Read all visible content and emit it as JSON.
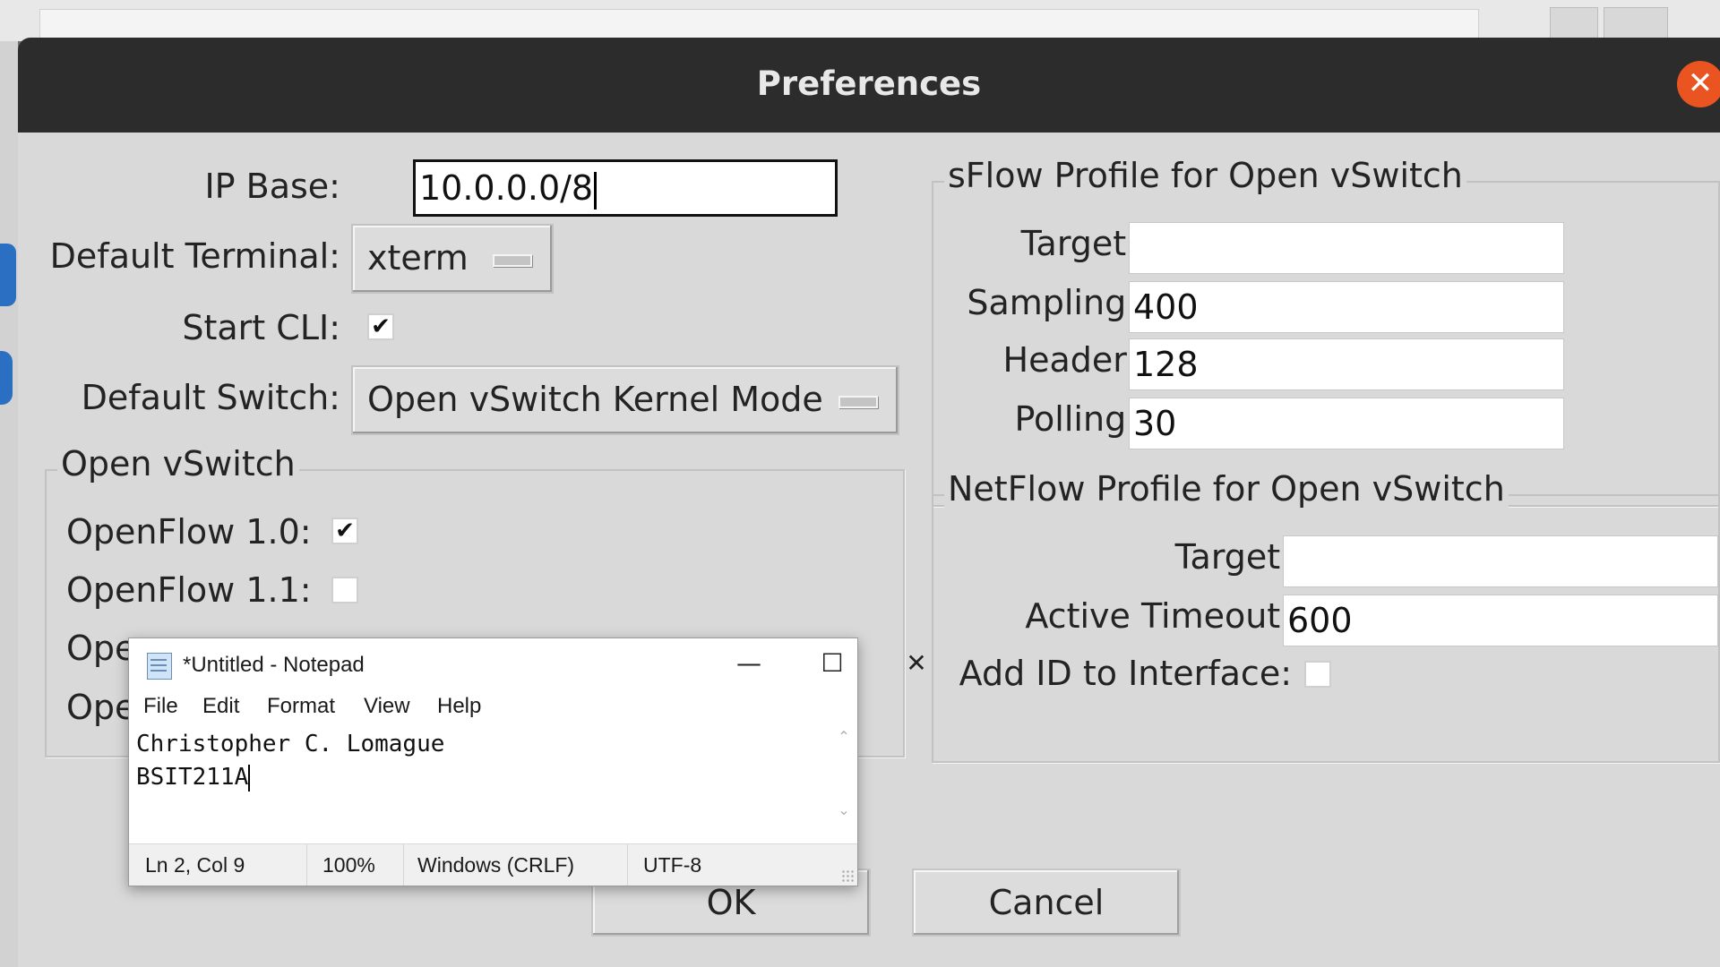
{
  "dialog": {
    "title": "Preferences",
    "close_glyph": "✕"
  },
  "left": {
    "ip_base_label": "IP Base:",
    "ip_base_value": "10.0.0.0/8",
    "default_terminal_label": "Default Terminal:",
    "default_terminal_value": "xterm",
    "start_cli_label": "Start CLI:",
    "start_cli_checked": "✔",
    "default_switch_label": "Default Switch:",
    "default_switch_value": "Open vSwitch Kernel Mode"
  },
  "ovs_group": {
    "title": "Open vSwitch",
    "items": [
      {
        "label": "OpenFlow 1.0:",
        "checked": "✔"
      },
      {
        "label": "OpenFlow 1.1:",
        "checked": ""
      },
      {
        "label": "Ope",
        "checked": ""
      },
      {
        "label": "Ope",
        "checked": ""
      }
    ]
  },
  "sflow": {
    "title": "sFlow Profile for Open vSwitch",
    "target_label": "Target:",
    "target_value": "",
    "sampling_label": "Sampling:",
    "sampling_value": "400",
    "header_label": "Header:",
    "header_value": "128",
    "polling_label": "Polling:",
    "polling_value": "30"
  },
  "netflow": {
    "title": "NetFlow Profile for Open vSwitch",
    "target_label": "Target:",
    "target_value": "",
    "active_timeout_label": "Active Timeout:",
    "active_timeout_value": "600",
    "add_id_label": "Add ID to Interface:",
    "add_id_checked": ""
  },
  "buttons": {
    "ok": "OK",
    "cancel": "Cancel"
  },
  "notepad": {
    "title": "*Untitled - Notepad",
    "minimize": "—",
    "maximize": "☐",
    "close": "✕",
    "menu": [
      "File",
      "Edit",
      "Format",
      "View",
      "Help"
    ],
    "lines": [
      "Christopher C. Lomague",
      "BSIT211A"
    ],
    "status": {
      "position": "Ln 2, Col 9",
      "zoom": "100%",
      "line_ending": "Windows (CRLF)",
      "encoding": "UTF-8"
    },
    "scroll_up": "⌃",
    "scroll_down": "⌄"
  },
  "colors": {
    "titlebar": "#2c2c2c",
    "close_button": "#e95420",
    "dialog_bg": "#d9d9d9"
  }
}
